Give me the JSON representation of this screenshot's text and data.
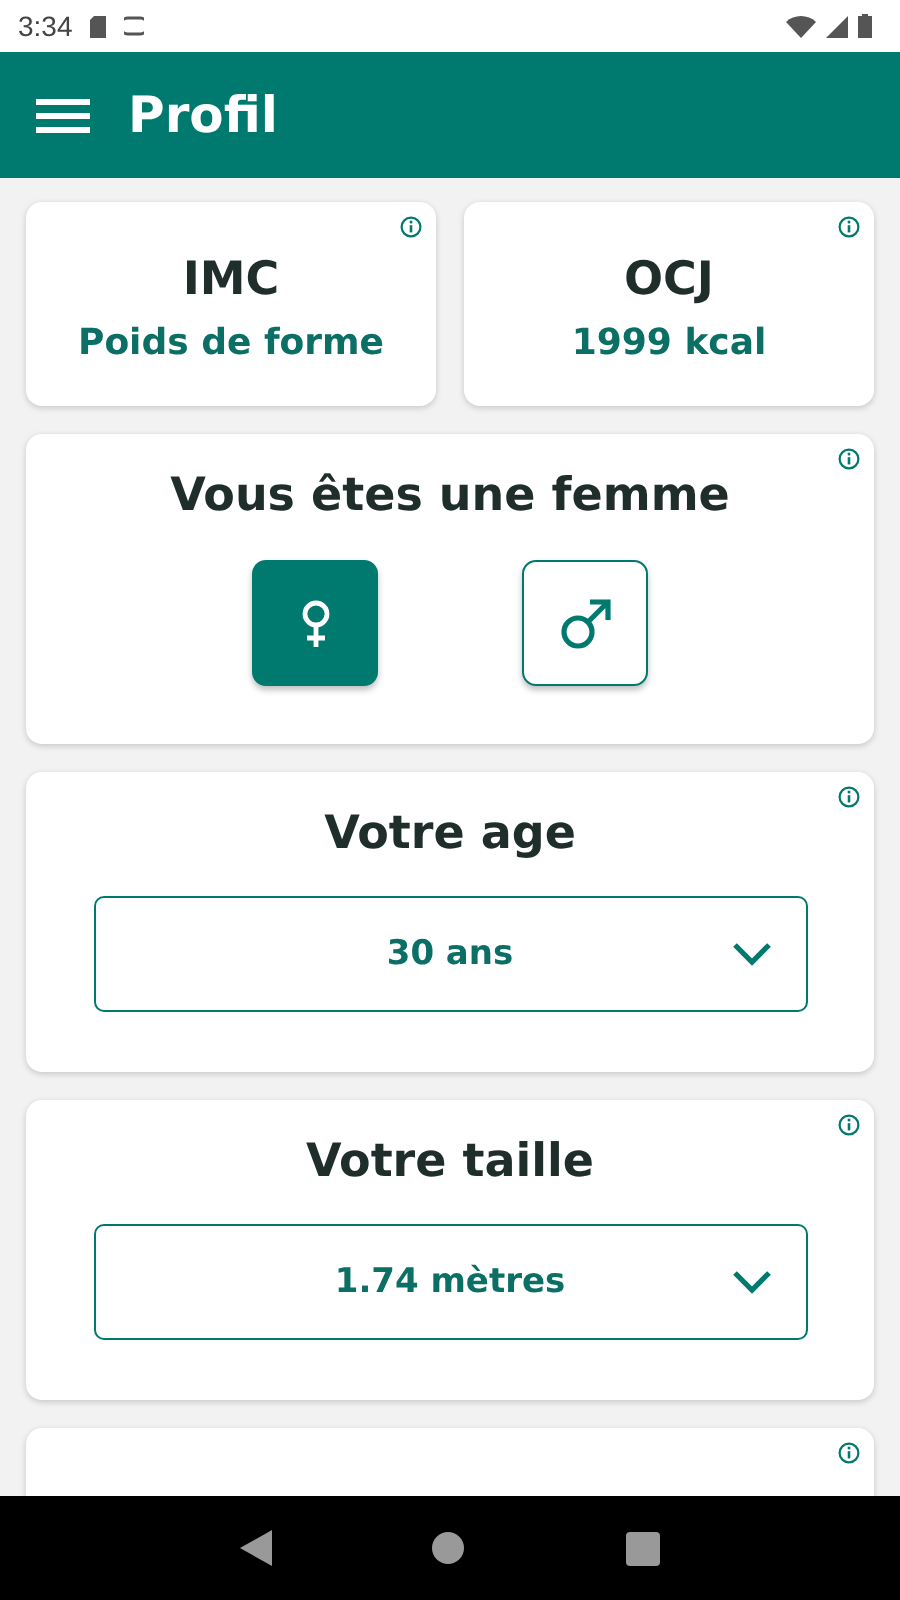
{
  "status_bar": {
    "time": "3:34"
  },
  "app_bar": {
    "title": "Profil"
  },
  "summary_cards": [
    {
      "title": "IMC",
      "value": "Poids de forme"
    },
    {
      "title": "OCJ",
      "value": "1999 kcal"
    }
  ],
  "gender_card": {
    "title": "Vous êtes une femme",
    "options": [
      {
        "kind": "female",
        "selected": true
      },
      {
        "kind": "male",
        "selected": false
      }
    ]
  },
  "select_cards": [
    {
      "title": "Votre age",
      "value": "30 ans"
    },
    {
      "title": "Votre taille",
      "value": "1.74 mètres"
    }
  ]
}
